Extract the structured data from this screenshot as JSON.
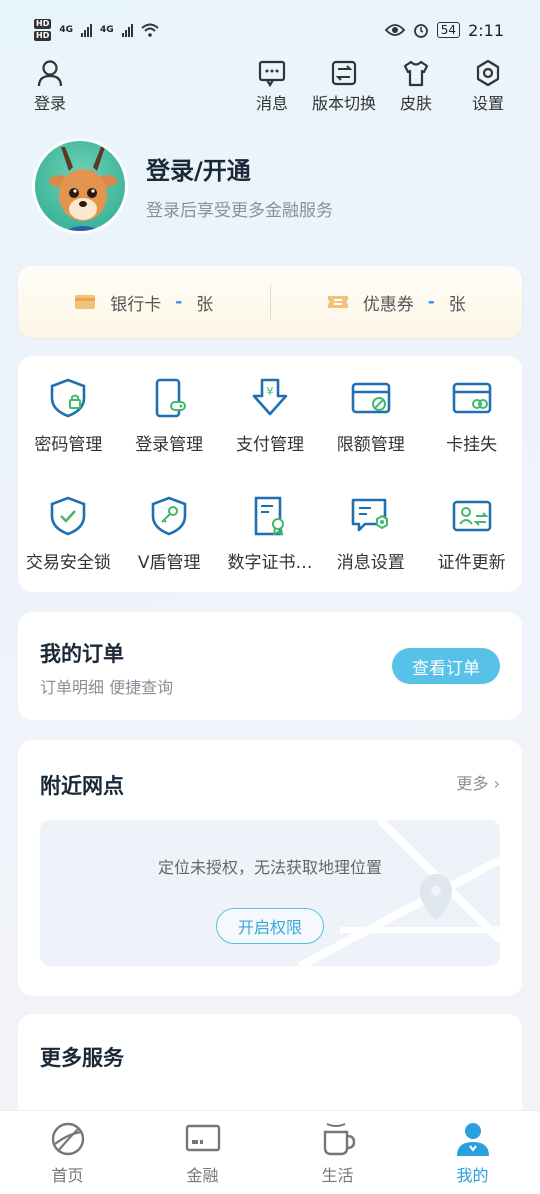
{
  "status_bar": {
    "time": "2:11",
    "battery": "54",
    "signal_left": "4G",
    "signal_right": "4G",
    "hd_1": "HD",
    "hd_2": "HD"
  },
  "header": {
    "login_label": "登录",
    "actions": [
      {
        "label": "消息",
        "icon": "message-icon"
      },
      {
        "label": "版本切换",
        "icon": "switch-icon"
      },
      {
        "label": "皮肤",
        "icon": "shirt-icon"
      },
      {
        "label": "设置",
        "icon": "gear-icon"
      }
    ]
  },
  "profile": {
    "title": "登录/开通",
    "subtitle": "登录后享受更多金融服务"
  },
  "cards": {
    "bank_card_label": "银行卡",
    "bank_card_count": "-",
    "bank_card_unit": "张",
    "coupon_label": "优惠券",
    "coupon_count": "-",
    "coupon_unit": "张"
  },
  "services": [
    {
      "label": "密码管理",
      "icon": "password-shield-icon"
    },
    {
      "label": "登录管理",
      "icon": "phone-login-icon"
    },
    {
      "label": "支付管理",
      "icon": "payment-download-icon"
    },
    {
      "label": "限额管理",
      "icon": "card-limit-icon"
    },
    {
      "label": "卡挂失",
      "icon": "card-lost-icon"
    },
    {
      "label": "交易安全锁",
      "icon": "shield-check-icon"
    },
    {
      "label": "V盾管理",
      "icon": "shield-key-icon"
    },
    {
      "label": "数字证书…",
      "icon": "certificate-icon"
    },
    {
      "label": "消息设置",
      "icon": "message-settings-icon"
    },
    {
      "label": "证件更新",
      "icon": "id-update-icon"
    }
  ],
  "orders": {
    "title": "我的订单",
    "subtitle": "订单明细 便捷查询",
    "button": "查看订单"
  },
  "nearby": {
    "title": "附近网点",
    "more": "更多",
    "message": "定位未授权，无法获取地理位置",
    "button": "开启权限"
  },
  "more_services": {
    "title": "更多服务"
  },
  "tabbar": [
    {
      "label": "首页",
      "icon": "home-icon",
      "active": false
    },
    {
      "label": "金融",
      "icon": "finance-card-icon",
      "active": false
    },
    {
      "label": "生活",
      "icon": "cup-icon",
      "active": false
    },
    {
      "label": "我的",
      "icon": "user-icon",
      "active": true
    }
  ],
  "colors": {
    "accent": "#57c1e8",
    "icon_blue": "#1f6fb2",
    "icon_green": "#43b86a",
    "active_tab": "#2aa0dc"
  }
}
